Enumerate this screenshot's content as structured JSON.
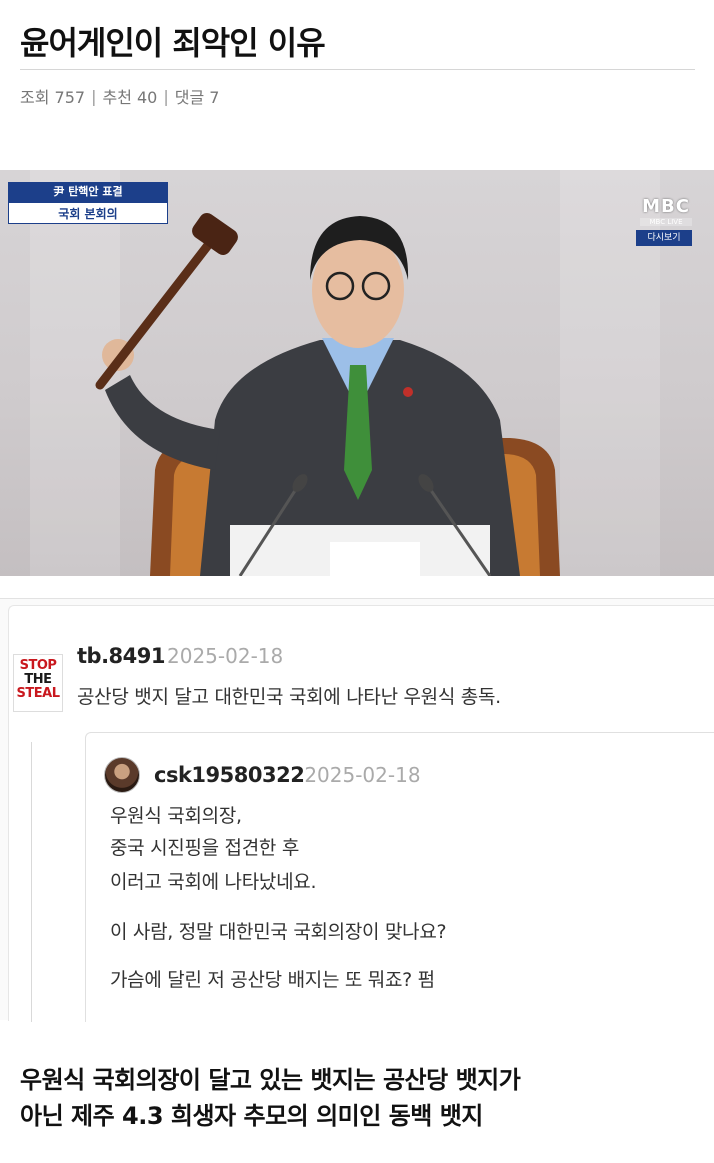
{
  "post": {
    "title": "윤어게인이 죄악인 이유",
    "meta": {
      "views": "조회 757",
      "likes": "추천 40",
      "comments": "댓글 7",
      "separator": "|"
    }
  },
  "tv_image": {
    "caption_top": "尹 탄핵안 표결",
    "caption_bottom": "국회 본회의",
    "broadcaster": "MBC",
    "broadcaster_sub": "MBC LIVE",
    "replay_badge": "다시보기",
    "colors": {
      "caption_blue": "#1c3f8a",
      "tie_green": "#3f8f3a"
    }
  },
  "comment": {
    "avatar_text": [
      "STOP",
      "THE",
      "STEAL"
    ],
    "author": "tb.8491",
    "date": "2025-02-18",
    "body": "공산당 뱃지 달고 대한민국 국회에 나타난 우원식 총독.",
    "reply": {
      "author": "csk19580322",
      "date": "2025-02-18",
      "lines": [
        "우원식 국회의장,",
        "중국 시진핑을 접견한 후",
        "이러고 국회에 나타났네요.",
        "이 사람, 정말 대한민국 국회의장이 맞나요?",
        "가슴에 달린 저 공산당 배지는 또 뭐죠? 펌"
      ]
    }
  },
  "footer": {
    "line1": "우원식 국회의장이 달고 있는 뱃지는 공산당 뱃지가",
    "line2": "아닌 제주 4.3 희생자 추모의 의미인 동백 뱃지"
  }
}
